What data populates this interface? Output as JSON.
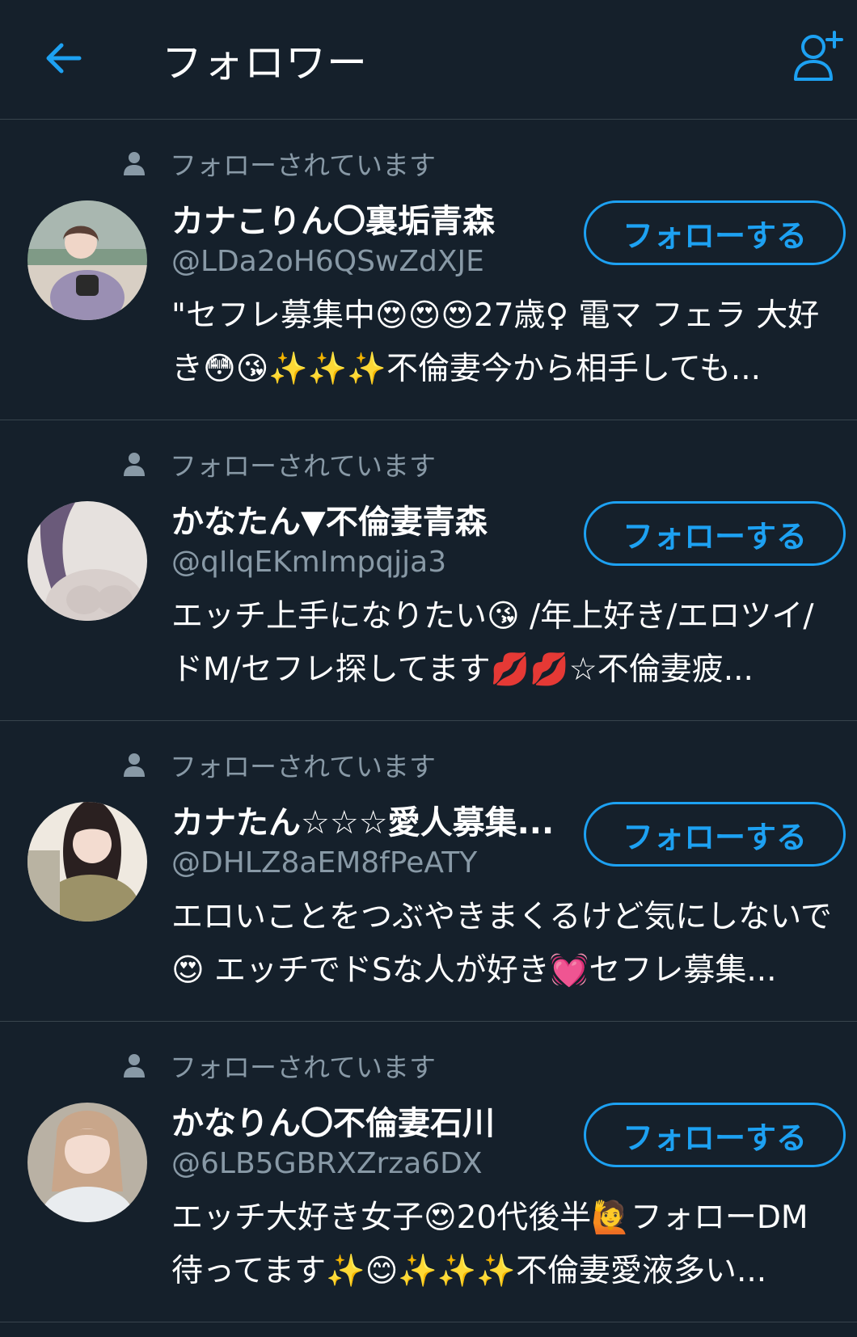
{
  "header": {
    "title": "フォロワー",
    "back_icon": "arrow-left-icon",
    "add_icon": "add-user-icon",
    "accent_color": "#1da1f2"
  },
  "followers": [
    {
      "followed_label": "フォローされています",
      "name": "カナこりん〇裏垢青森",
      "handle": "@LDa2oH6QSwZdXJE",
      "follow_label": "フォローする",
      "bio": "\"セフレ募集中😍😍😍27歳♀ 電マ フェラ 大好き😳😘✨✨✨不倫妻今から相手しても..."
    },
    {
      "followed_label": "フォローされています",
      "name": "かなたん▼不倫妻青森",
      "handle": "@qIlqEKmImpqjja3",
      "follow_label": "フォローする",
      "bio": "エッチ上手になりたい😘 /年上好き/エロツイ/ドM/セフレ探してます💋💋☆不倫妻疲..."
    },
    {
      "followed_label": "フォローされています",
      "name": "カナたん☆☆☆愛人募集...",
      "handle": "@DHLZ8aEM8fPeATY",
      "follow_label": "フォローする",
      "bio": "エロいことをつぶやきまくるけど気にしないで😍 エッチでドSな人が好き💓セフレ募集..."
    },
    {
      "followed_label": "フォローされています",
      "name": "かなりん〇不倫妻石川",
      "handle": "@6LB5GBRXZrza6DX",
      "follow_label": "フォローする",
      "bio": "エッチ大好き女子😍20代後半🙋フォローDM待ってます✨😊✨✨✨不倫妻愛液多い..."
    }
  ]
}
